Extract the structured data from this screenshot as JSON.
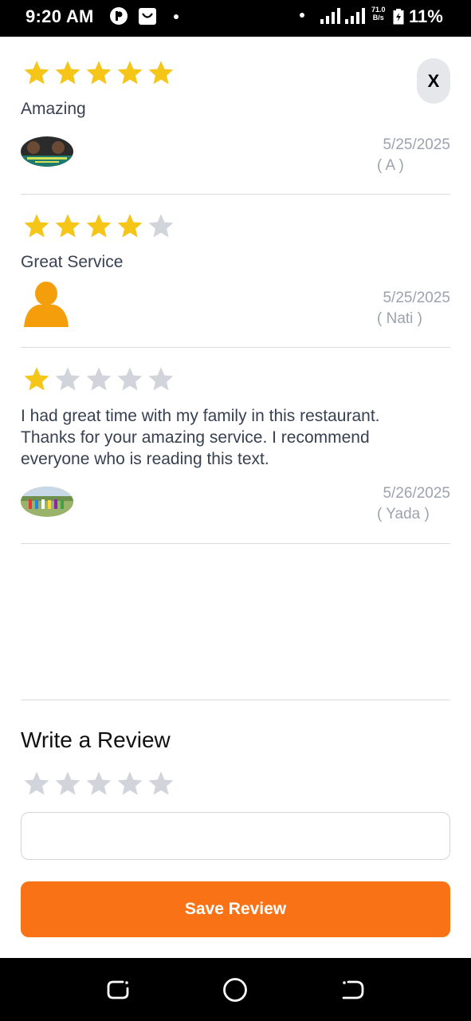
{
  "status_bar": {
    "time": "9:20 AM",
    "speed_value": "71.0",
    "speed_unit": "B/s",
    "battery_percent": "11%",
    "icons": [
      "app-p-icon",
      "shopping-bag-icon",
      "notification-dot-icon",
      "signal-icon",
      "signal-icon",
      "battery-charging-icon"
    ]
  },
  "dialog": {
    "close_label": "X"
  },
  "reviews": [
    {
      "rating": 5,
      "text": "Amazing",
      "date": "5/25/2025",
      "author": "( A )",
      "avatar": "photo-thumbnail"
    },
    {
      "rating": 4,
      "text": "Great Service",
      "date": "5/25/2025",
      "author": "( Nati )",
      "avatar": "default-user-icon"
    },
    {
      "rating": 1,
      "text": "I had great time with my family in this restaurant. Thanks for your amazing service. I recommend everyone who is reading this text.",
      "date": "5/26/2025",
      "author": "( Yada )",
      "avatar": "photo-thumbnail"
    }
  ],
  "write_review": {
    "title": "Write a Review",
    "rating": 0,
    "input_value": "",
    "save_label": "Save Review"
  },
  "colors": {
    "star_filled": "#F5C518",
    "star_empty": "#D1D5DB",
    "accent": "#F97316",
    "avatar_default": "#F59E0B"
  },
  "nav_bar": {
    "icons": [
      "recent-apps-icon",
      "home-icon",
      "back-icon"
    ]
  }
}
